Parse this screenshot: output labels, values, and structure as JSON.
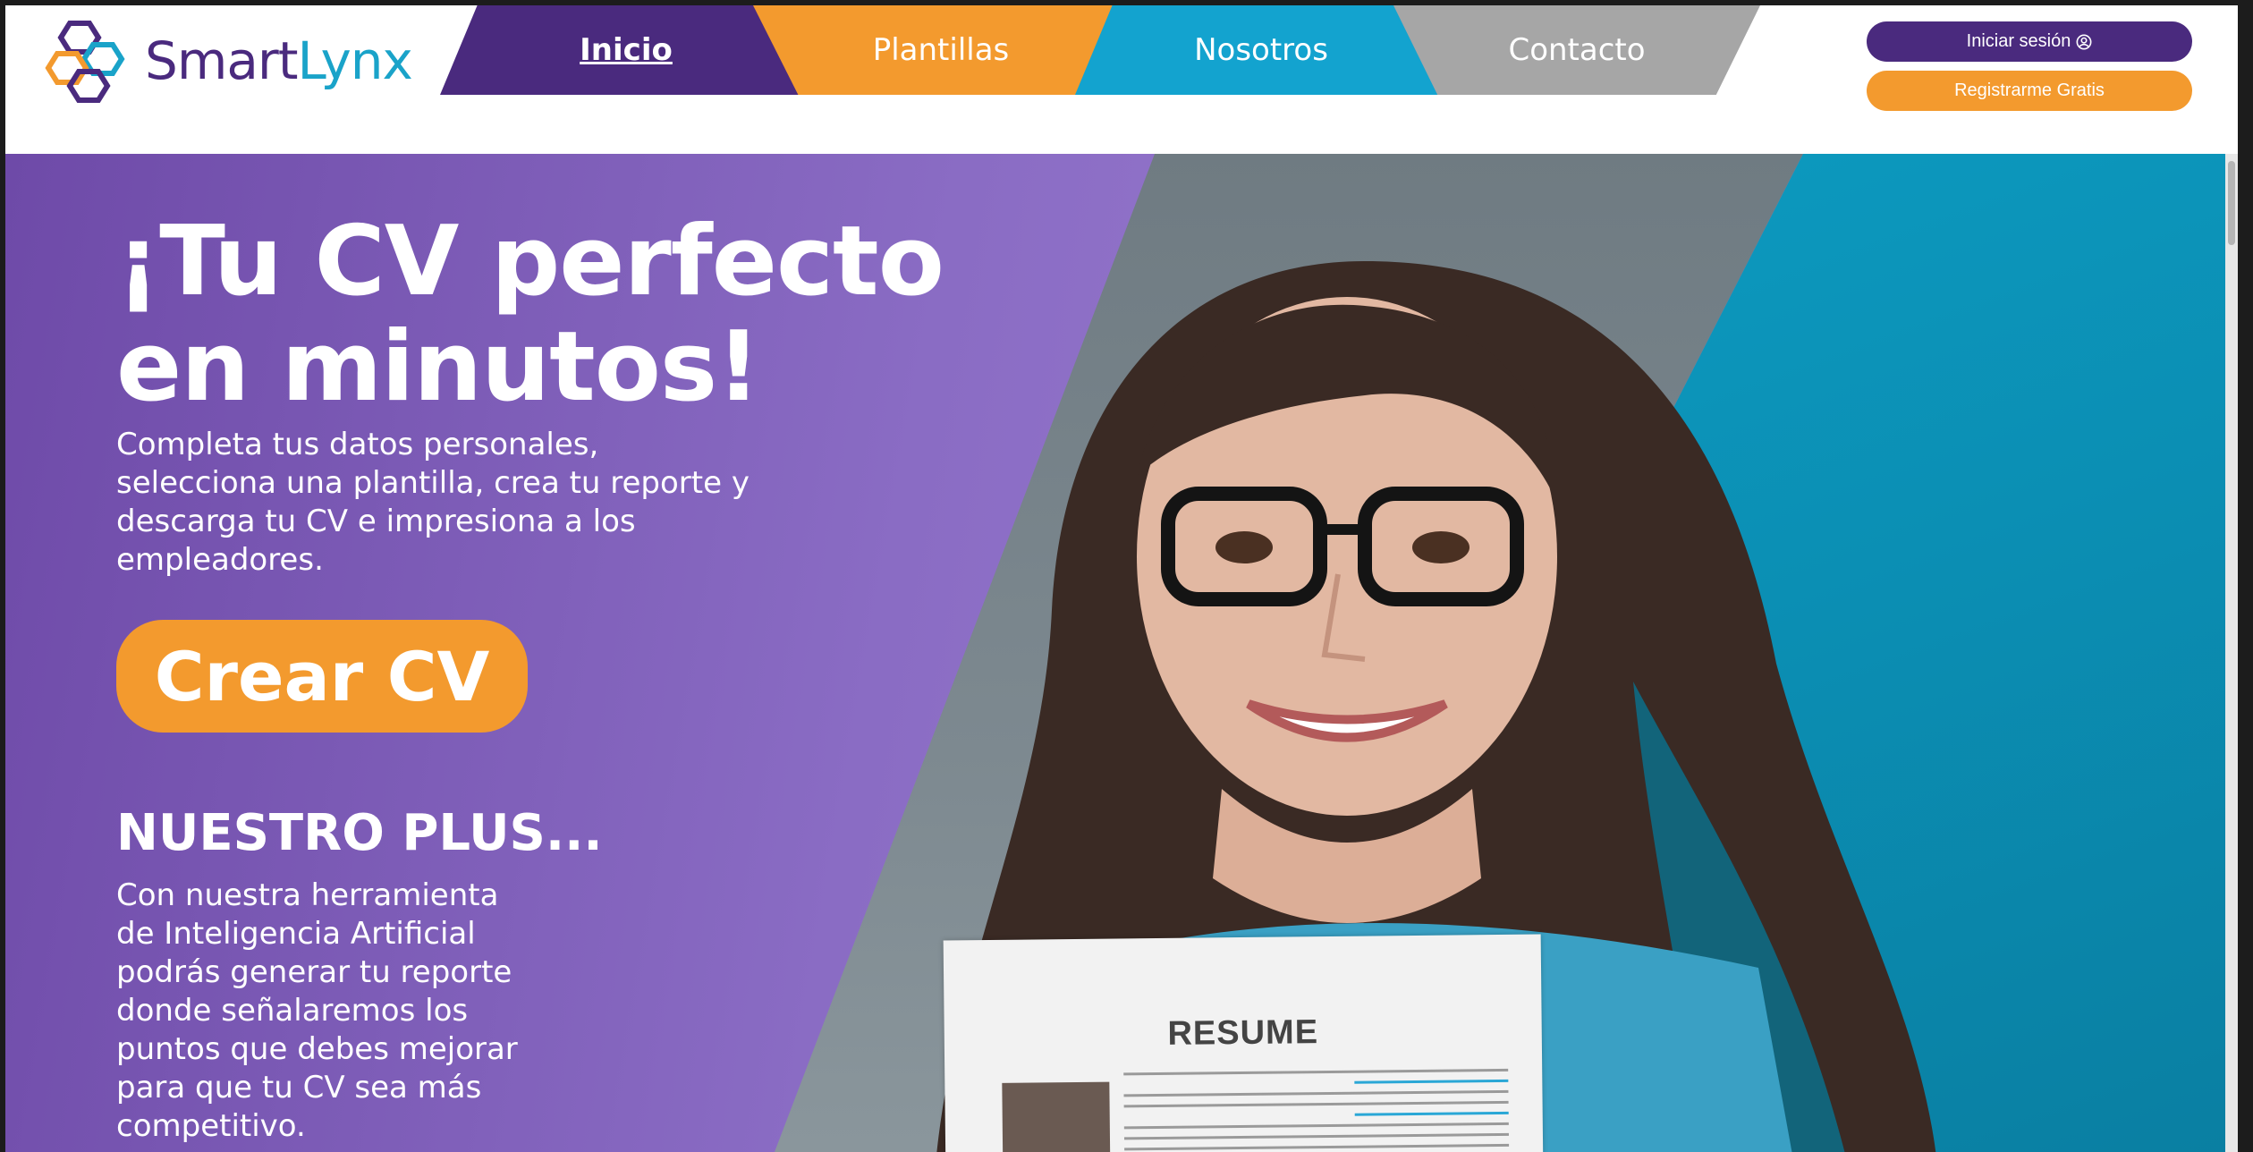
{
  "brand": {
    "name_part1": "Smart",
    "name_part2": "Lynx"
  },
  "nav": {
    "items": [
      {
        "label": "Inicio",
        "active": true,
        "color": "#4a2a7e"
      },
      {
        "label": "Plantillas",
        "color": "#f39a2e"
      },
      {
        "label": "Nosotros",
        "color": "#13a3cf"
      },
      {
        "label": "Contacto",
        "color": "#a6a6a6"
      }
    ]
  },
  "auth": {
    "login_label": "Iniciar sesión",
    "login_icon": "user-circle-icon",
    "register_label": "Registrarme Gratis"
  },
  "hero": {
    "headline_line1": "¡Tu CV perfecto",
    "headline_line2": "en minutos!",
    "subtext": "Completa tus datos personales, selecciona una plantilla, crea tu reporte y descarga tu CV e impresiona a los empleadores.",
    "cta_label": "Crear CV",
    "plus_title": "NUESTRO PLUS...",
    "plus_text": "Con nuestra herramienta de Inteligencia Artificial podrás generar tu reporte donde señalaremos los puntos que debes mejorar para que tu CV sea más competitivo.",
    "resume_title": "RESUME"
  },
  "colors": {
    "purple": "#4a2a7e",
    "orange": "#f39a2e",
    "cyan": "#13a3cf",
    "gray": "#a6a6a6"
  }
}
